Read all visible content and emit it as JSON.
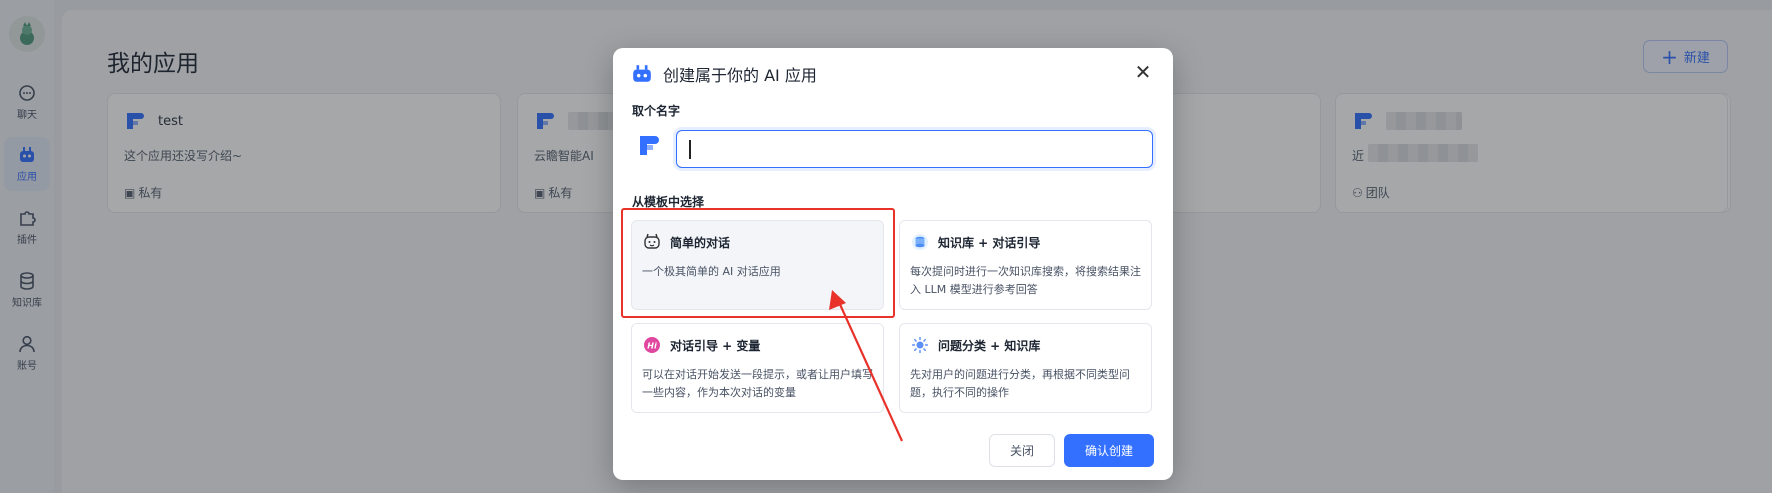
{
  "sidebar": {
    "items": [
      {
        "label": "聊天",
        "icon": "chat-icon"
      },
      {
        "label": "应用",
        "icon": "robot-icon",
        "active": true
      },
      {
        "label": "插件",
        "icon": "puzzle-icon"
      },
      {
        "label": "知识库",
        "icon": "database-icon"
      },
      {
        "label": "账号",
        "icon": "user-icon"
      }
    ]
  },
  "main": {
    "title": "我的应用",
    "new_button": "新建",
    "apps": [
      {
        "name": "test",
        "intro": "这个应用还没写介绍~",
        "visibility": "私有"
      },
      {
        "name": "",
        "intro": "云瞻智能AI",
        "visibility": "私有"
      },
      {
        "name": "",
        "intro": "",
        "visibility": ""
      },
      {
        "name": "",
        "intro": "",
        "visibility": ""
      },
      {
        "name": "",
        "intro": "近",
        "visibility": "团队"
      }
    ]
  },
  "dialog": {
    "title": "创建属于你的 AI 应用",
    "name_label": "取个名字",
    "name_value": "",
    "template_label": "从模板中选择",
    "templates": [
      {
        "name": "简单的对话",
        "desc": "一个极其简单的 AI 对话应用",
        "icon": "simple-chat-icon",
        "selected": true
      },
      {
        "name": "知识库 + 对话引导",
        "desc": "每次提问时进行一次知识库搜索，将搜索结果注入 LLM 模型进行参考回答",
        "icon": "kb-guide-icon"
      },
      {
        "name": "对话引导 + 变量",
        "desc": "可以在对话开始发送一段提示，或者让用户填写一些内容，作为本次对话的变量",
        "icon": "hi-guide-icon"
      },
      {
        "name": "问题分类 + 知识库",
        "desc": "先对用户的问题进行分类，再根据不同类型问题，执行不同的操作",
        "icon": "classify-icon"
      }
    ],
    "close_button": "关闭",
    "confirm_button": "确认创建"
  },
  "colors": {
    "accent": "#3370ff",
    "annotation": "#e8322a"
  }
}
